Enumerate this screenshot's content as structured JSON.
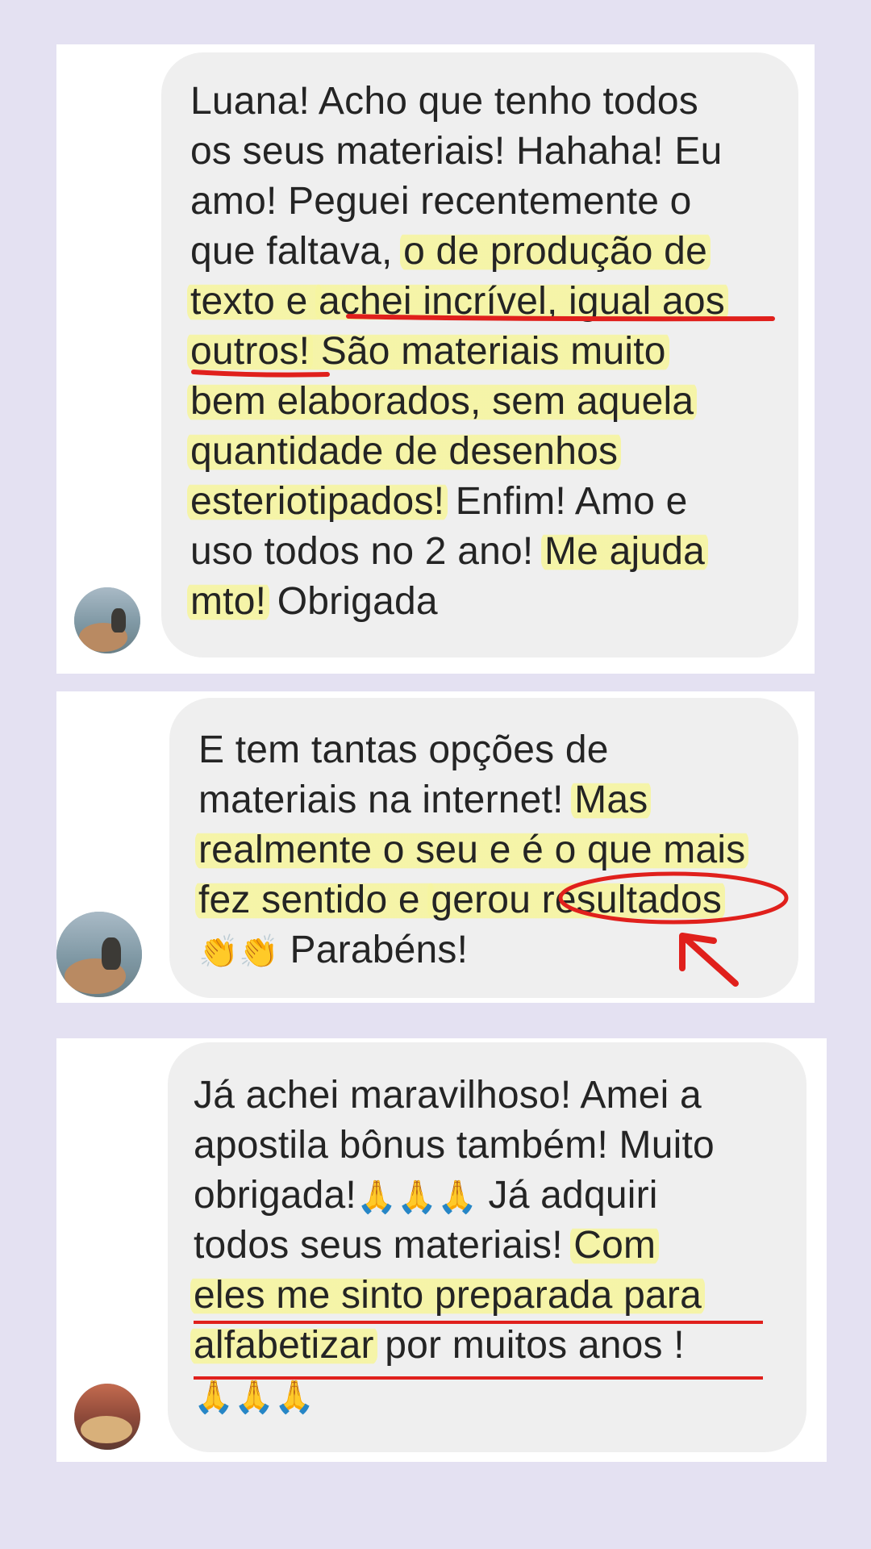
{
  "messages": [
    {
      "lines": [
        [
          {
            "t": "Luana! Acho que tenho todos"
          }
        ],
        [
          {
            "t": "os seus materiais! Hahaha! Eu"
          }
        ],
        [
          {
            "t": "amo! Peguei recentemente o"
          }
        ],
        [
          {
            "t": "que faltava, "
          },
          {
            "t": "o de produção de",
            "hl": true
          }
        ],
        [
          {
            "t": "texto e ",
            "hl": true
          },
          {
            "t": "achei incrível, igual aos",
            "hl": true
          }
        ],
        [
          {
            "t": "outros!",
            "hl": true
          },
          {
            "t": " São materiais muito",
            "hl": true
          }
        ],
        [
          {
            "t": "bem elaborados, sem aquela",
            "hl": true
          }
        ],
        [
          {
            "t": "quantidade de desenhos",
            "hl": true
          }
        ],
        [
          {
            "t": "esteriotipados!",
            "hl": true
          },
          {
            "t": " Enfim! Amo e"
          }
        ],
        [
          {
            "t": "uso todos no 2 ano! "
          },
          {
            "t": "Me ajuda",
            "hl": true
          }
        ],
        [
          {
            "t": "mto!",
            "hl": true
          },
          {
            "t": " Obrigada"
          }
        ]
      ]
    },
    {
      "lines": [
        [
          {
            "t": "E tem tantas opções de"
          }
        ],
        [
          {
            "t": "materiais na internet! "
          },
          {
            "t": "Mas",
            "hl": true
          }
        ],
        [
          {
            "t": "realmente o seu e é o que mais",
            "hl": true
          }
        ],
        [
          {
            "t": "fez sentido e ",
            "hl": true
          },
          {
            "t": "gerou resultados",
            "hl": true
          }
        ],
        [
          {
            "t": "👏👏",
            "emoji": true
          },
          {
            "t": " Parabéns!"
          }
        ]
      ]
    },
    {
      "lines": [
        [
          {
            "t": "Já achei maravilhoso! Amei a"
          }
        ],
        [
          {
            "t": "apostila bônus também! Muito"
          }
        ],
        [
          {
            "t": "obrigada!"
          },
          {
            "t": "🙏🙏🙏",
            "emoji": true
          },
          {
            "t": " Já adquiri"
          }
        ],
        [
          {
            "t": "todos seus materiais! "
          },
          {
            "t": "Com",
            "hl": true
          }
        ],
        [
          {
            "t": "eles me sinto preparada para",
            "hl": true
          }
        ],
        [
          {
            "t": "alfabetizar",
            "hl": true
          },
          {
            "t": " por muitos anos !"
          }
        ],
        [
          {
            "t": "🙏🙏🙏",
            "emoji": true
          }
        ]
      ]
    }
  ],
  "colors": {
    "background": "#e4e1f2",
    "card": "#ffffff",
    "bubble": "#efefef",
    "highlight": "#f6f5a0",
    "annotation_red": "#e0201c",
    "text": "#242424"
  },
  "icons": [
    "clapping-hands-emoji",
    "folded-hands-emoji",
    "avatar-photo",
    "red-arrow-annotation"
  ]
}
